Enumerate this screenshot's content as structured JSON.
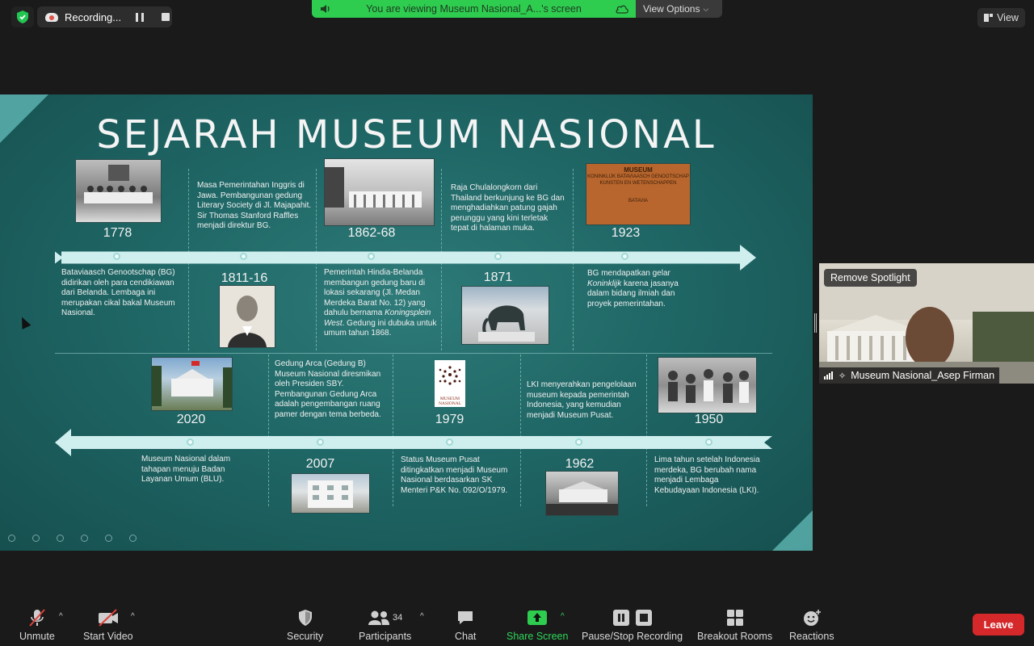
{
  "top": {
    "recording_label": "Recording...",
    "viewing_text": "You are viewing Museum Nasional_A...'s screen",
    "view_options_label": "View Options",
    "view_label": "View"
  },
  "slide": {
    "title": "SEJARAH MUSEUM NASIONAL",
    "events": [
      {
        "year": "1778",
        "text": "Bataviaasch Genootschap (BG) didirikan oleh para cendikiawan dari Belanda. Lembaga ini merupakan cikal bakal Museum Nasional."
      },
      {
        "year": "1811-16",
        "text": "Masa Pemerintahan Inggris di Jawa. Pembangunan gedung Literary Society di Jl. Majapahit. Sir Thomas Stanford Raffles menjadi direktur BG."
      },
      {
        "year": "1862-68",
        "text_pre": "Pemerintah Hindia-Belanda membangun gedung baru di lokasi sekarang (Jl. Medan Merdeka Barat No. 12) yang dahulu bernama ",
        "text_em": "Koningsplein West",
        "text_post": ". Gedung ini dubuka untuk umum tahun 1868."
      },
      {
        "year": "1871",
        "text": "Raja Chulalongkorn  dari Thailand berkunjung ke BG dan menghadiahkan patung gajah perunggu yang kini terletak tepat di halaman muka."
      },
      {
        "year": "1923",
        "text_pre": "BG mendapatkan gelar ",
        "text_em": "Koninklijk",
        "text_post": " karena jasanya dalam bidang ilmiah dan proyek pemerintahan."
      },
      {
        "year": "1950",
        "text": "Lima tahun setelah Indonesia merdeka, BG berubah nama menjadi Lembaga Kebudayaan Indonesia (LKI)."
      },
      {
        "year": "1962",
        "text": "LKI menyerahkan pengelolaan museum kepada pemerintah Indonesia, yang kemudian menjadi Museum Pusat."
      },
      {
        "year": "1979",
        "text": "Status Museum Pusat ditingkatkan menjadi Museum Nasional berdasarkan SK Menteri P&K No. 092/O/1979."
      },
      {
        "year": "2007",
        "text": "Gedung Arca (Gedung B) Museum Nasional diresmikan oleh Presiden SBY. Pembangunan Gedung Arca adalah pengembangan ruang pamer dengan tema berbeda."
      },
      {
        "year": "2020",
        "text": "Museum Nasional dalam tahapan menuju Badan Layanan Umum (BLU)."
      }
    ],
    "book_cover_lines": [
      "MUSEUM",
      "KONINKLIJK BATAVIAASCH GENOOTSCHAP",
      "KUNSTEN EN WETENSCHAPPEN",
      "BATAVIA"
    ],
    "logo_text": "MUSEUM NASIONAL"
  },
  "video": {
    "spotlight_label": "Remove Spotlight",
    "participant_name": "Museum Nasional_Asep Firman"
  },
  "toolbar": {
    "unmute": "Unmute",
    "start_video": "Start Video",
    "security": "Security",
    "participants": "Participants",
    "participants_count": "34",
    "chat": "Chat",
    "share_screen": "Share Screen",
    "pause_stop": "Pause/Stop Recording",
    "breakout": "Breakout Rooms",
    "reactions": "Reactions",
    "leave": "Leave"
  },
  "colors": {
    "accent_green": "#2ecc4f",
    "leave_red": "#d5282b",
    "slide_teal": "#1f6766"
  }
}
